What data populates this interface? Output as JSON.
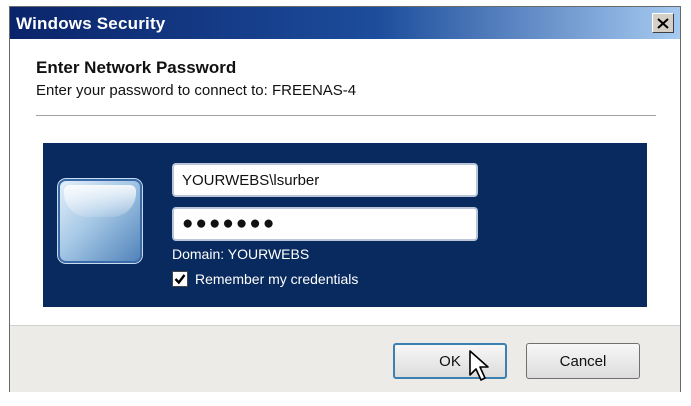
{
  "window": {
    "title": "Windows Security"
  },
  "dialog": {
    "heading": "Enter Network Password",
    "subheading": "Enter your password to connect to: FREENAS-4"
  },
  "credentials": {
    "username": "YOURWEBS\\lsurber",
    "password_masked": "●●●●●●●",
    "domain_label": "Domain: YOURWEBS",
    "remember_label": "Remember my credentials",
    "remember_checked": true
  },
  "buttons": {
    "ok": "OK",
    "cancel": "Cancel"
  },
  "colors": {
    "title_bar": "#0a246a",
    "panel": "#082a5e",
    "footer": "#ecebe8"
  },
  "icons": {
    "user_tile": "user-tile-icon",
    "close": "close-icon",
    "check": "checkmark-icon",
    "cursor": "mouse-pointer-icon"
  }
}
